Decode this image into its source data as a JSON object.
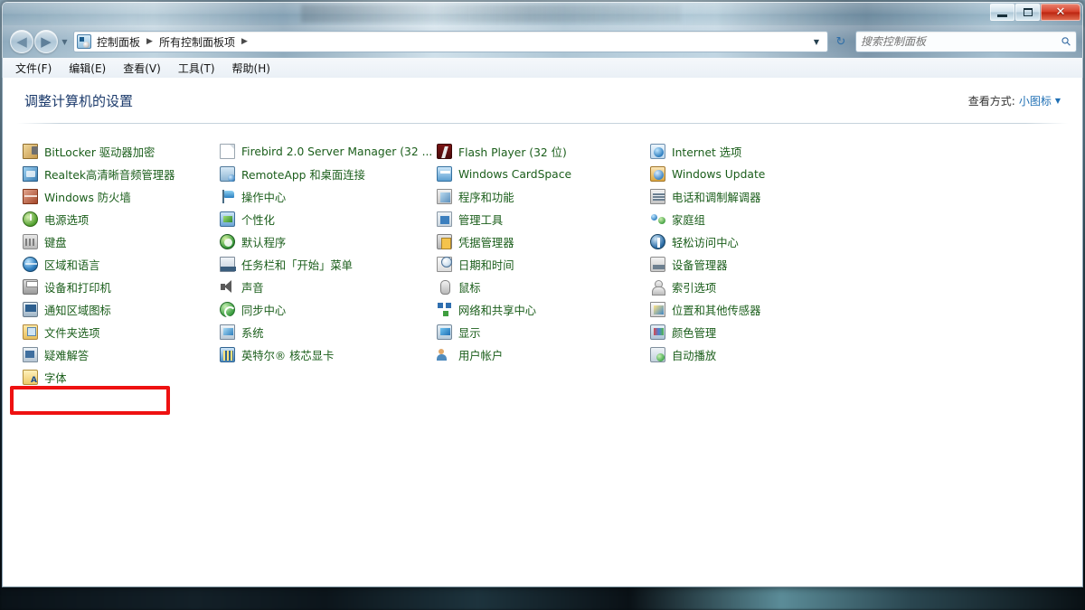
{
  "window": {
    "controls": {
      "minimize": "最小化",
      "maximize": "最大化",
      "close": "✕"
    }
  },
  "nav": {
    "back": "◀",
    "forward": "▶",
    "recent_caret": "▼",
    "breadcrumb": {
      "icon": "control-panel-icon",
      "items": [
        "控制面板",
        "所有控制面板项"
      ],
      "separator": "▶",
      "trailing_separator": "▶"
    },
    "address_dropdown": "▼",
    "refresh": "↻"
  },
  "search": {
    "value": "",
    "placeholder": "搜索控制面板",
    "icon": "search-icon"
  },
  "menubar": {
    "items": [
      "文件(F)",
      "编辑(E)",
      "查看(V)",
      "工具(T)",
      "帮助(H)"
    ]
  },
  "page": {
    "title": "调整计算机的设置",
    "view_by_label": "查看方式:",
    "view_by_value": "小图标",
    "view_by_caret": "▼"
  },
  "columns": [
    {
      "items": [
        {
          "label": "BitLocker 驱动器加密",
          "icon": "bitlocker"
        },
        {
          "label": "Realtek高清晰音频管理器",
          "icon": "realtek"
        },
        {
          "label": "Windows 防火墙",
          "icon": "firewall"
        },
        {
          "label": "电源选项",
          "icon": "power"
        },
        {
          "label": "键盘",
          "icon": "keyboard"
        },
        {
          "label": "区域和语言",
          "icon": "region"
        },
        {
          "label": "设备和打印机",
          "icon": "devprint"
        },
        {
          "label": "通知区域图标",
          "icon": "notify"
        },
        {
          "label": "文件夹选项",
          "icon": "folderopt"
        },
        {
          "label": "疑难解答",
          "icon": "trouble"
        },
        {
          "label": "字体",
          "icon": "fonts"
        }
      ]
    },
    {
      "items": [
        {
          "label": "Firebird 2.0 Server Manager (32 ...",
          "icon": "doc"
        },
        {
          "label": "RemoteApp 和桌面连接",
          "icon": "remoteapp"
        },
        {
          "label": "操作中心",
          "icon": "actioncenter"
        },
        {
          "label": "个性化",
          "icon": "personal"
        },
        {
          "label": "默认程序",
          "icon": "defaultprog"
        },
        {
          "label": "任务栏和「开始」菜单",
          "icon": "taskbar"
        },
        {
          "label": "声音",
          "icon": "sound"
        },
        {
          "label": "同步中心",
          "icon": "sync"
        },
        {
          "label": "系统",
          "icon": "system"
        },
        {
          "label": "英特尔® 核芯显卡",
          "icon": "intel"
        }
      ]
    },
    {
      "items": [
        {
          "label": "Flash Player (32 位)",
          "icon": "flash"
        },
        {
          "label": "Windows CardSpace",
          "icon": "cardspace"
        },
        {
          "label": "程序和功能",
          "icon": "programs"
        },
        {
          "label": "管理工具",
          "icon": "admin"
        },
        {
          "label": "凭据管理器",
          "icon": "cred"
        },
        {
          "label": "日期和时间",
          "icon": "datetime"
        },
        {
          "label": "鼠标",
          "icon": "mouse"
        },
        {
          "label": "网络和共享中心",
          "icon": "network"
        },
        {
          "label": "显示",
          "icon": "display"
        },
        {
          "label": "用户帐户",
          "icon": "useracct"
        }
      ]
    },
    {
      "items": [
        {
          "label": "Internet 选项",
          "icon": "internet"
        },
        {
          "label": "Windows Update",
          "icon": "winupdate"
        },
        {
          "label": "电话和调制解调器",
          "icon": "phone"
        },
        {
          "label": "家庭组",
          "icon": "homegroup"
        },
        {
          "label": "轻松访问中心",
          "icon": "ease"
        },
        {
          "label": "设备管理器",
          "icon": "devmgr"
        },
        {
          "label": "索引选项",
          "icon": "index"
        },
        {
          "label": "位置和其他传感器",
          "icon": "location"
        },
        {
          "label": "颜色管理",
          "icon": "color"
        },
        {
          "label": "自动播放",
          "icon": "autoplay"
        }
      ]
    }
  ],
  "annotation": {
    "target": "区域和语言",
    "color": "#ee1111"
  }
}
